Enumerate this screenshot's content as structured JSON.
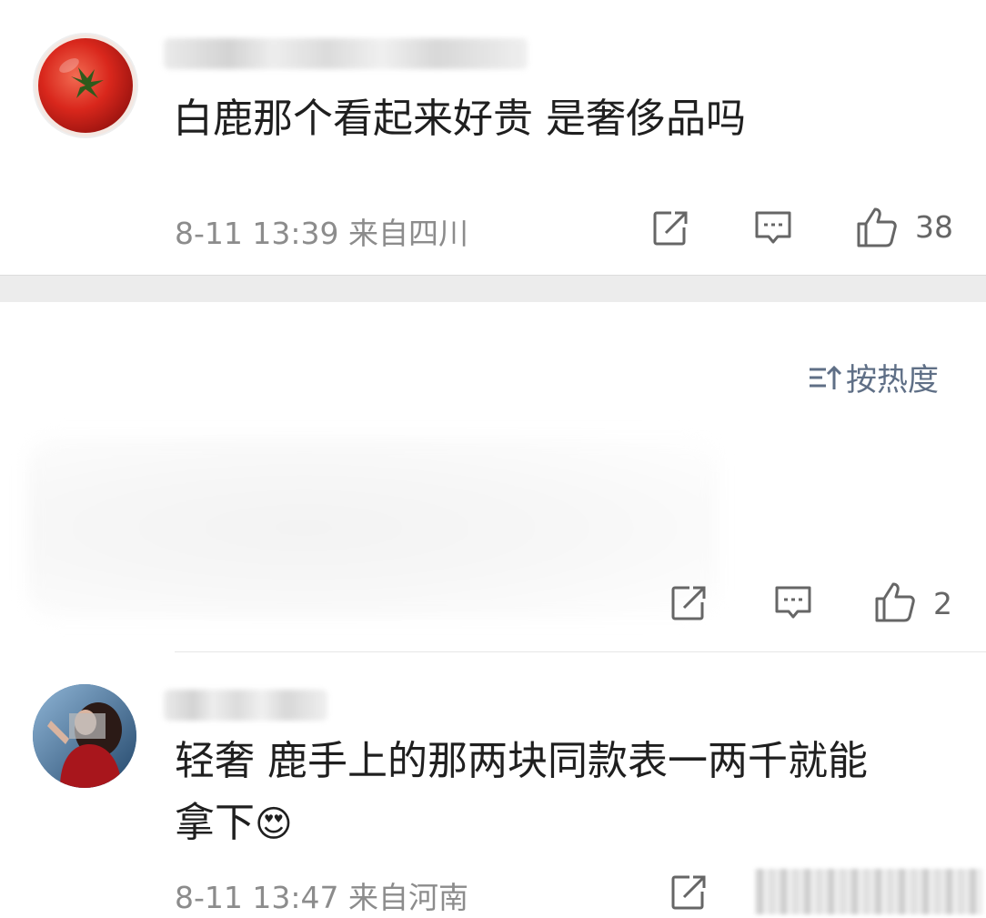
{
  "comments": [
    {
      "text": "白鹿那个看起来好贵 是奢侈品吗",
      "meta": "8-11 13:39  来自四川",
      "likes": "38"
    },
    {
      "likes": "2"
    },
    {
      "text_line1": "轻奢 鹿手上的那两块同款表一两千就能",
      "text_line2": "拿下",
      "emoji": "😍",
      "meta": "8-11 13:47  来自河南"
    }
  ],
  "sort": {
    "label": "按热度",
    "icon": "sort-icon"
  },
  "icons": {
    "share": "share-icon",
    "reply": "comment-icon",
    "like": "thumbs-up-icon"
  },
  "colors": {
    "meta_text": "#8c8c8c",
    "sort_text": "#5f6f86",
    "divider_band": "#ececec"
  }
}
